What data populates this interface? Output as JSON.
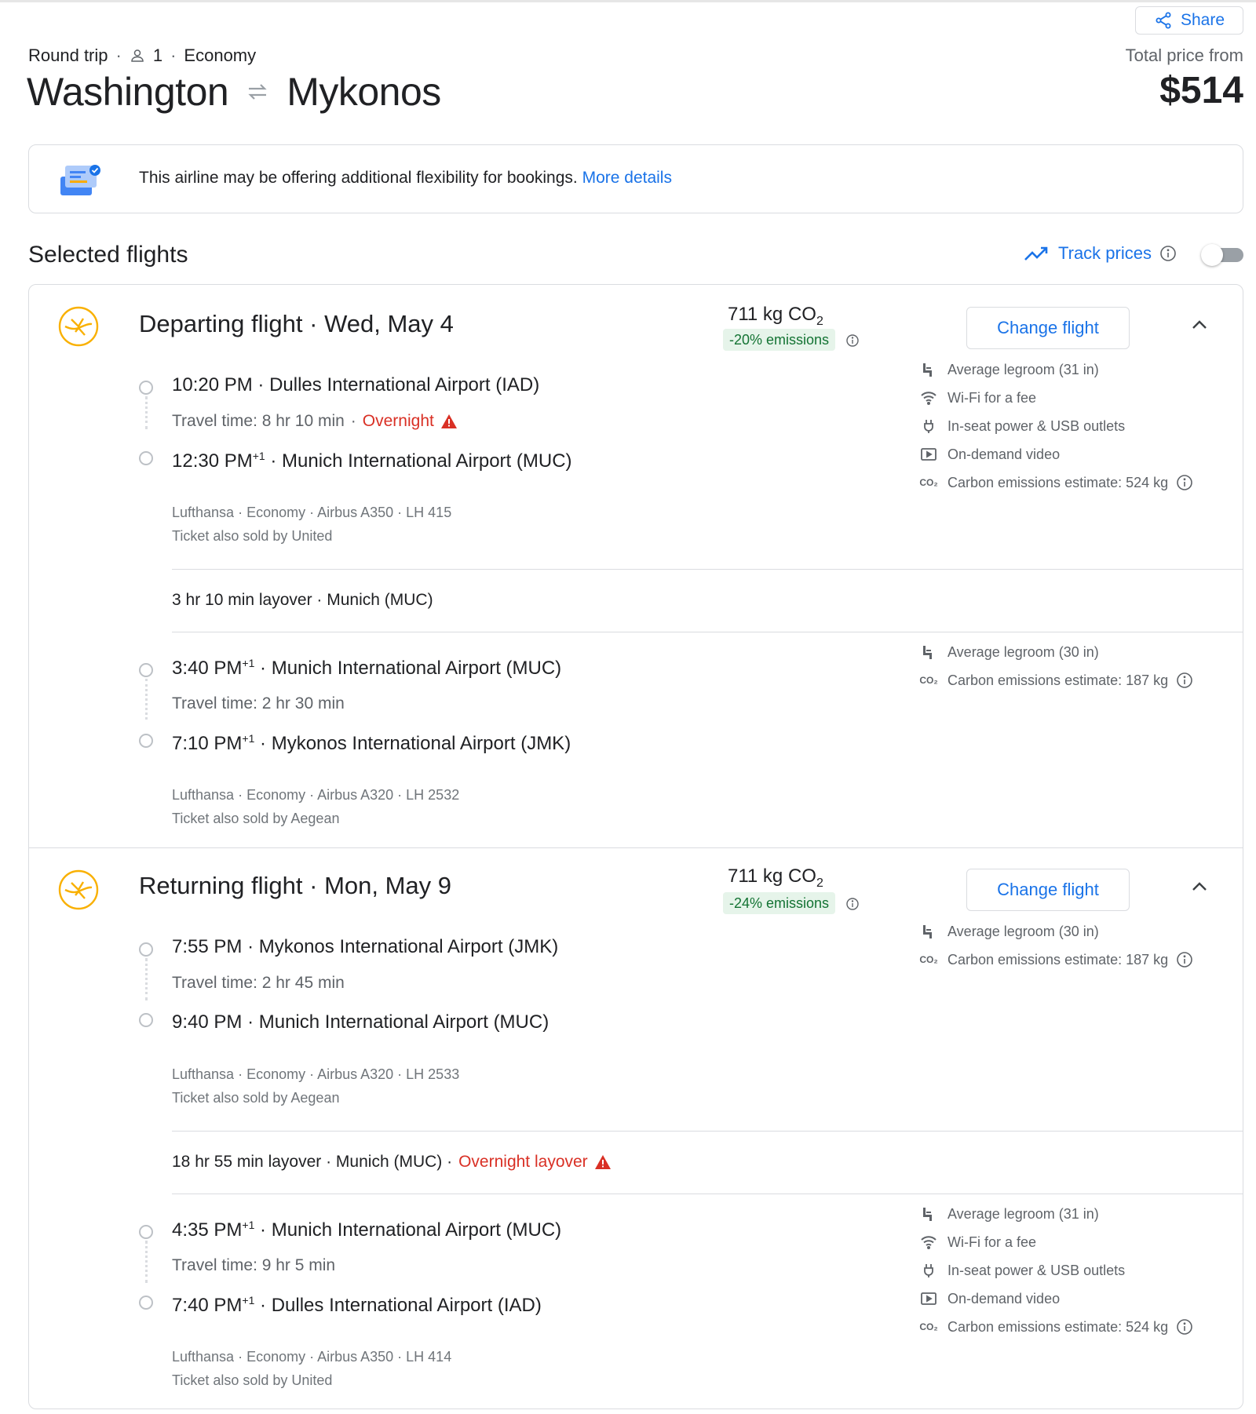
{
  "header": {
    "share_label": "Share",
    "trip_type": "Round trip",
    "passengers": "1",
    "cabin": "Economy",
    "origin": "Washington",
    "destination": "Mykonos",
    "price_label": "Total price from",
    "price": "$514"
  },
  "banner": {
    "text": "This airline may be offering additional flexibility for bookings.",
    "link": "More details"
  },
  "selected": {
    "title": "Selected flights",
    "track_label": "Track prices"
  },
  "colors": {
    "accent": "#1a73e8",
    "warning": "#d93025",
    "eco_bg": "#e6f4ea",
    "eco_text": "#137333",
    "lufthansa": "#f9b000"
  },
  "departing": {
    "title": "Departing flight",
    "date": "Wed, May 4",
    "co2": "711 kg CO",
    "co2_sub": "2",
    "emissions": "-20% emissions",
    "change_label": "Change flight",
    "seg1": {
      "dep_time": "10:20 PM",
      "dep_airport": "Dulles International Airport (IAD)",
      "travel": "Travel time: 8 hr 10 min",
      "overnight": "Overnight",
      "arr_time": "12:30 PM",
      "arr_plus": "+1",
      "arr_airport": "Munich International Airport (MUC)",
      "details": "Lufthansa · Economy · Airbus A350 · LH 415",
      "sold_by": "Ticket also sold by United",
      "legroom": "Average legroom (31 in)",
      "wifi": "Wi-Fi for a fee",
      "power": "In-seat power & USB outlets",
      "video": "On-demand video",
      "carbon": "Carbon emissions estimate: 524 kg"
    },
    "layover": "3 hr 10 min layover · Munich (MUC)",
    "seg2": {
      "dep_time": "3:40 PM",
      "dep_plus": "+1",
      "dep_airport": "Munich International Airport (MUC)",
      "travel": "Travel time: 2 hr 30 min",
      "arr_time": "7:10 PM",
      "arr_plus": "+1",
      "arr_airport": "Mykonos International Airport (JMK)",
      "details": "Lufthansa · Economy · Airbus A320 · LH 2532",
      "sold_by": "Ticket also sold by Aegean",
      "legroom": "Average legroom (30 in)",
      "carbon": "Carbon emissions estimate: 187 kg"
    }
  },
  "returning": {
    "title": "Returning flight",
    "date": "Mon, May 9",
    "co2": "711 kg CO",
    "co2_sub": "2",
    "emissions": "-24% emissions",
    "change_label": "Change flight",
    "seg1": {
      "dep_time": "7:55 PM",
      "dep_airport": "Mykonos International Airport (JMK)",
      "travel": "Travel time: 2 hr 45 min",
      "arr_time": "9:40 PM",
      "arr_airport": "Munich International Airport (MUC)",
      "details": "Lufthansa · Economy · Airbus A320 · LH 2533",
      "sold_by": "Ticket also sold by Aegean",
      "legroom": "Average legroom (30 in)",
      "carbon": "Carbon emissions estimate: 187 kg"
    },
    "layover": "18 hr 55 min layover · Munich (MUC) ·",
    "layover_warn": "Overnight layover",
    "seg2": {
      "dep_time": "4:35 PM",
      "dep_plus": "+1",
      "dep_airport": "Munich International Airport (MUC)",
      "travel": "Travel time: 9 hr 5 min",
      "arr_time": "7:40 PM",
      "arr_plus": "+1",
      "arr_airport": "Dulles International Airport (IAD)",
      "details": "Lufthansa · Economy · Airbus A350 · LH 414",
      "sold_by": "Ticket also sold by United",
      "legroom": "Average legroom (31 in)",
      "wifi": "Wi-Fi for a fee",
      "power": "In-seat power & USB outlets",
      "video": "On-demand video",
      "carbon": "Carbon emissions estimate: 524 kg"
    }
  }
}
